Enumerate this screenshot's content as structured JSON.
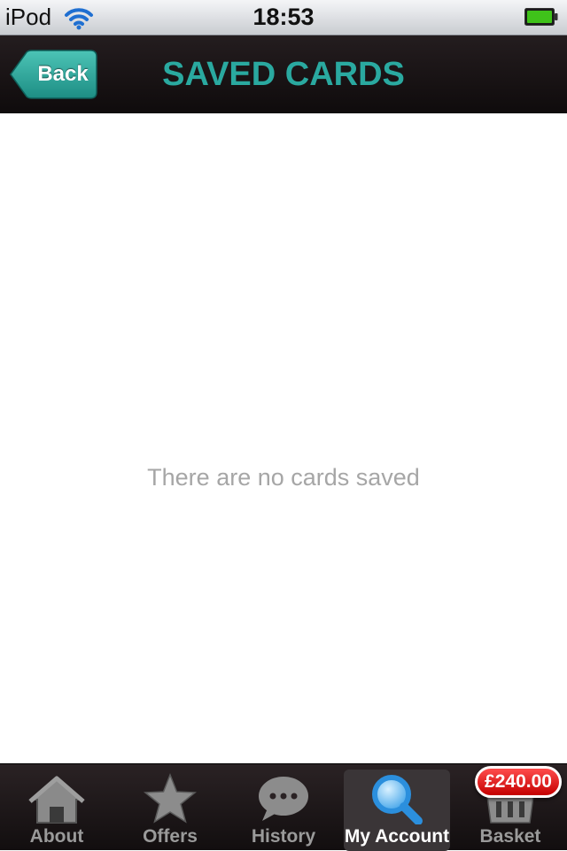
{
  "status_bar": {
    "carrier": "iPod",
    "time": "18:53"
  },
  "nav": {
    "back_label": "Back",
    "title": "SAVED CARDS"
  },
  "content": {
    "empty_message": "There are no cards saved"
  },
  "tabs": [
    {
      "label": "About",
      "icon": "house-icon",
      "active": false
    },
    {
      "label": "Offers",
      "icon": "star-icon",
      "active": false
    },
    {
      "label": "History",
      "icon": "speech-bubble-icon",
      "active": false
    },
    {
      "label": "My Account",
      "icon": "magnifier-icon",
      "active": true
    },
    {
      "label": "Basket",
      "icon": "basket-icon",
      "active": false
    }
  ],
  "basket_badge": "£240.00",
  "colors": {
    "accent": "#2aa9a0",
    "badge": "#d40000",
    "battery": "#3fc21a"
  }
}
